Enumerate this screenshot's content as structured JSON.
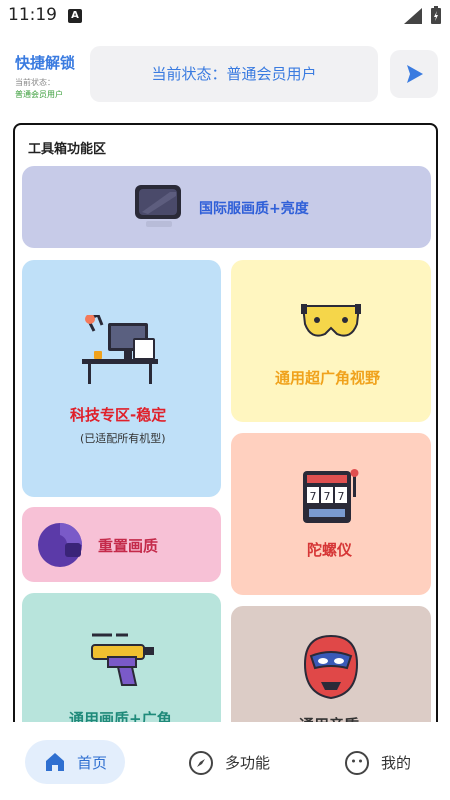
{
  "status_bar": {
    "time": "11:19",
    "sim_badge": "A"
  },
  "header": {
    "title": "快捷解锁",
    "status_caption": "当前状态：",
    "status_value": "普通会员用户",
    "state_pill": "当前状态：普通会员用户"
  },
  "panel": {
    "title": "工具箱功能区",
    "cards": {
      "intl": {
        "label": "国际服画质+亮度",
        "color": "#2f5fd8"
      },
      "tech": {
        "label": "科技专区-稳定",
        "sub": "(已适配所有机型)",
        "color": "#e0202a"
      },
      "wideview": {
        "label": "通用超广角视野",
        "color": "#f0a21c"
      },
      "reset": {
        "label": "重置画质",
        "color": "#c42a4a"
      },
      "gyro": {
        "label": "陀螺仪",
        "color": "#d63636"
      },
      "general": {
        "label": "通用画质+广角",
        "color": "#1f8a7a"
      },
      "audio": {
        "label": "通用音质",
        "color": "#333333"
      }
    }
  },
  "bottom_nav": {
    "home": "首页",
    "multi": "多功能",
    "mine": "我的"
  },
  "colors": {
    "accent": "#3a7be0"
  }
}
